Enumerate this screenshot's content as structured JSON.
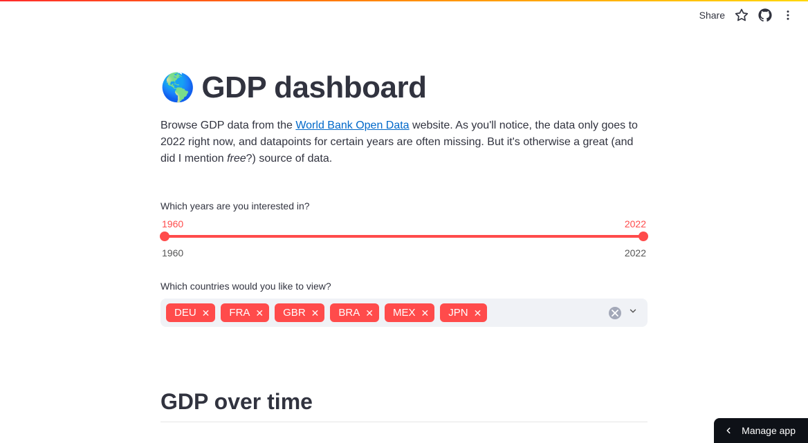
{
  "toolbar": {
    "share": "Share"
  },
  "header": {
    "emoji": "🌎",
    "title": "GDP dashboard"
  },
  "intro": {
    "p1a": "Browse GDP data from the ",
    "link": "World Bank Open Data",
    "p1b": " website. As you'll notice, the data only goes to 2022 right now, and datapoints for certain years are often missing. But it's otherwise a great (and did I mention ",
    "em": "free",
    "p1c": "?) source of data."
  },
  "slider": {
    "label": "Which years are you interested in?",
    "val_min": "1960",
    "val_max": "2022",
    "bound_min": "1960",
    "bound_max": "2022"
  },
  "countries": {
    "label": "Which countries would you like to view?",
    "tags": [
      "DEU",
      "FRA",
      "GBR",
      "BRA",
      "MEX",
      "JPN"
    ]
  },
  "section2": {
    "title": "GDP over time"
  },
  "manage": {
    "label": "Manage app"
  }
}
